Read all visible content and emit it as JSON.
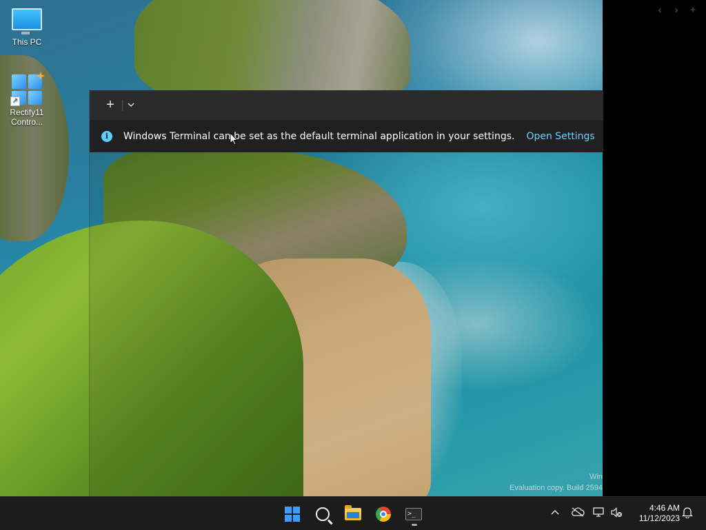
{
  "desktop": {
    "icons": [
      {
        "label": "This PC"
      },
      {
        "label": "Rectify11 Contro..."
      }
    ],
    "watermark": {
      "line1": "Win",
      "line2": "Evaluation copy. Build 2594"
    },
    "nav_arrows": {
      "back": "‹",
      "forward": "›",
      "add": "+"
    }
  },
  "terminal": {
    "titlebar": {
      "new_tab": "+",
      "dropdown": "⌄"
    },
    "infobar": {
      "icon": "info-icon",
      "message": "Windows Terminal can be set as the default terminal application in your settings.",
      "link": "Open Settings"
    }
  },
  "taskbar": {
    "apps": [
      "start-icon",
      "search-icon",
      "file-explorer-icon",
      "chrome-icon",
      "terminal-icon"
    ],
    "tray": {
      "chevron": "⌃",
      "time": "4:46 AM",
      "date": "11/12/2023"
    }
  },
  "colors": {
    "accent_link": "#6fd0ff",
    "info_icon": "#60cdff",
    "titlebar": "#2b2b2b",
    "infobar": "#202020",
    "taskbar": "#1c1c1c"
  }
}
